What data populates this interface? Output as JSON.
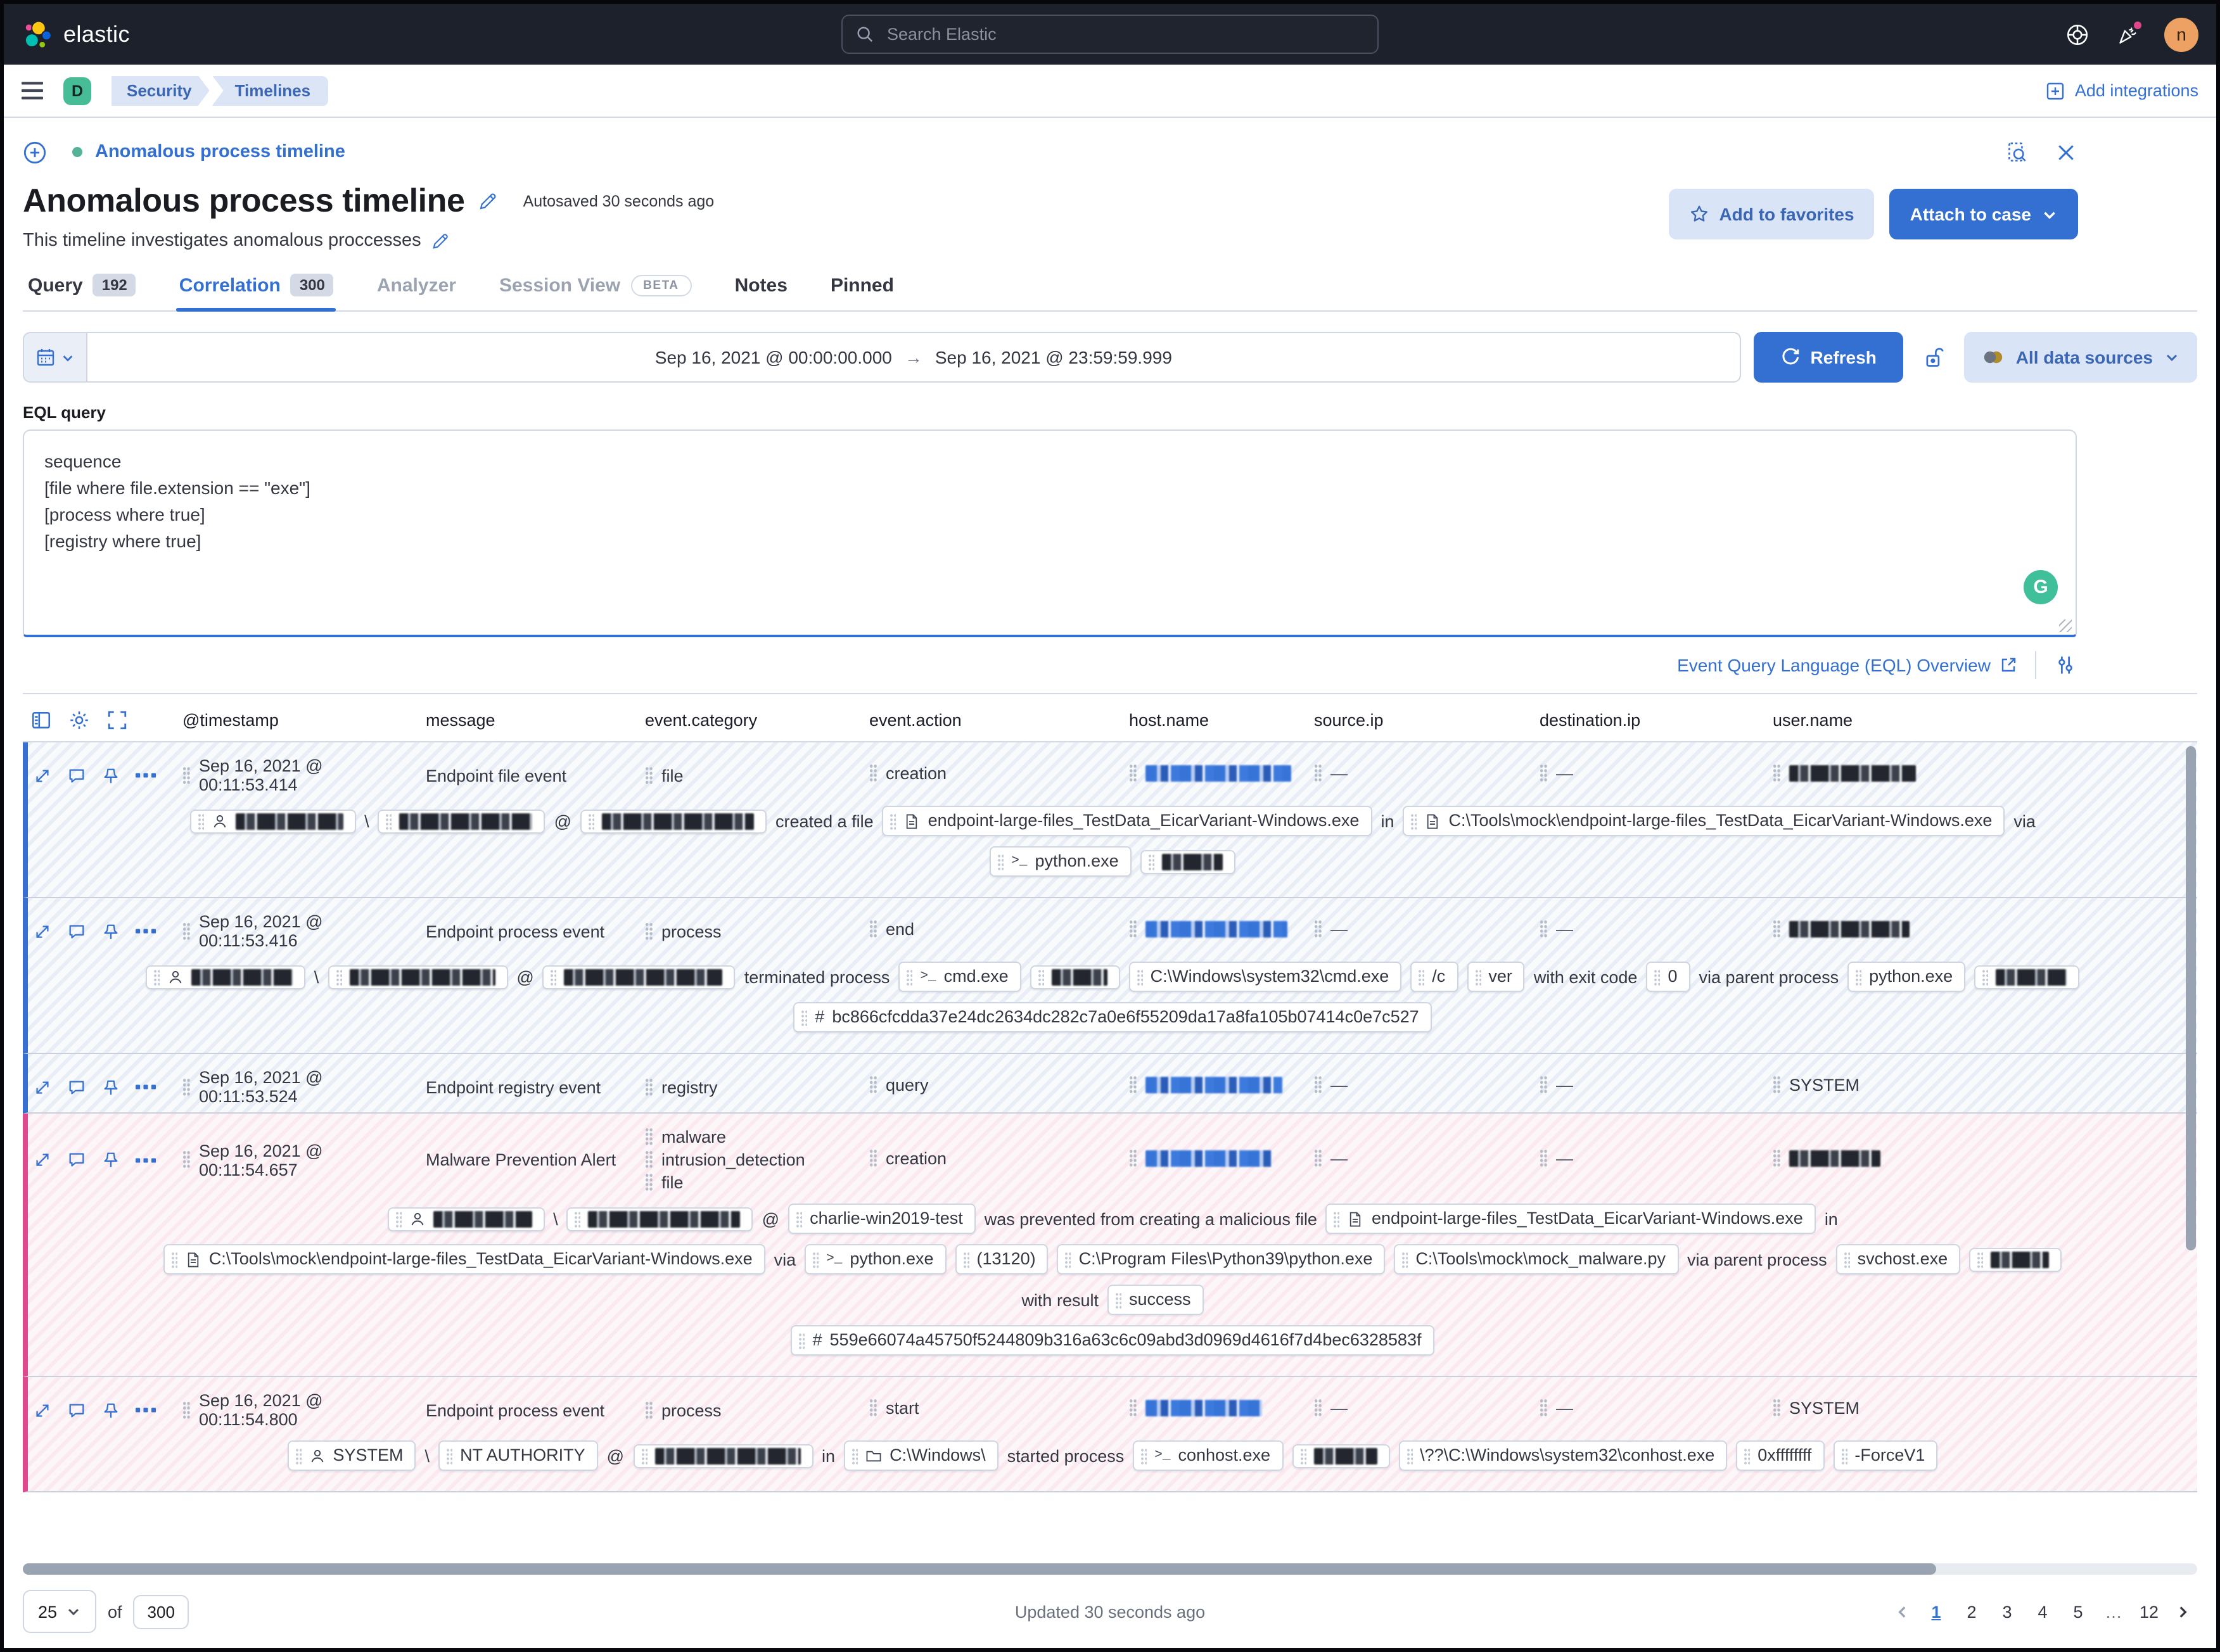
{
  "header": {
    "brand": "elastic",
    "search_placeholder": "Search Elastic",
    "avatar_initial": "n"
  },
  "nav": {
    "space_initial": "D",
    "breadcrumbs": [
      "Security",
      "Timelines"
    ],
    "add_integrations": "Add integrations"
  },
  "timeline": {
    "link_title": "Anomalous process timeline",
    "title": "Anomalous process timeline",
    "autosaved": "Autosaved 30 seconds ago",
    "description": "This timeline investigates anomalous proccesses",
    "favorites_button": "Add to favorites",
    "attach_button": "Attach to case"
  },
  "tabs": [
    {
      "label": "Query",
      "badge": "192"
    },
    {
      "label": "Correlation",
      "badge": "300"
    },
    {
      "label": "Analyzer"
    },
    {
      "label": "Session View",
      "beta": "BETA"
    },
    {
      "label": "Notes"
    },
    {
      "label": "Pinned"
    }
  ],
  "querybar": {
    "date_start": "Sep 16, 2021 @ 00:00:00.000",
    "range_arrow": "→",
    "date_end": "Sep 16, 2021 @ 23:59:59.999",
    "refresh": "Refresh",
    "data_sources": "All data sources"
  },
  "eql": {
    "label": "EQL query",
    "query": "sequence\n[file where file.extension == \"exe\"]\n[process where true]\n[registry where true]",
    "overview_link": "Event Query Language (EQL) Overview",
    "grammarly_badge": "G"
  },
  "table": {
    "columns": [
      "@timestamp",
      "message",
      "event.category",
      "event.action",
      "host.name",
      "source.ip",
      "destination.ip",
      "user.name"
    ],
    "rows": [
      {
        "kind": "event",
        "timestamp": "Sep 16, 2021 @ 00:11:53.414",
        "message": "Endpoint file event",
        "categories": [
          "file"
        ],
        "action": "creation",
        "host": {
          "redacted": "blue",
          "w": 115
        },
        "source_ip": "—",
        "destination_ip": "—",
        "user": {
          "redacted": "dark",
          "w": 100
        },
        "lines": [
          [
            {
              "chip": true,
              "icon": "user",
              "redacted": 85
            },
            {
              "text": "\\"
            },
            {
              "chip": true,
              "redacted": 105
            },
            {
              "text": "@"
            },
            {
              "chip": true,
              "redacted": 120
            },
            {
              "text": "created a file"
            },
            {
              "chip": true,
              "icon": "file",
              "text": "endpoint-large-files_TestData_EicarVariant-Windows.exe"
            },
            {
              "text": "in"
            },
            {
              "chip": true,
              "icon": "file",
              "text": "C:\\Tools\\mock\\endpoint-large-files_TestData_EicarVariant-Windows.exe"
            },
            {
              "text": "via"
            }
          ],
          [
            {
              "chip": true,
              "icon": "terminal",
              "text": "python.exe"
            },
            {
              "chip": true,
              "redacted": 48
            }
          ]
        ]
      },
      {
        "kind": "event",
        "timestamp": "Sep 16, 2021 @ 00:11:53.416",
        "message": "Endpoint process event",
        "categories": [
          "process"
        ],
        "action": "end",
        "host": {
          "redacted": "blue",
          "w": 112
        },
        "source_ip": "—",
        "destination_ip": "—",
        "user": {
          "redacted": "dark",
          "w": 95
        },
        "lines": [
          [
            {
              "chip": true,
              "icon": "user",
              "redacted": 80
            },
            {
              "text": "\\"
            },
            {
              "chip": true,
              "redacted": 115
            },
            {
              "text": "@"
            },
            {
              "chip": true,
              "redacted": 125
            },
            {
              "text": "terminated process"
            },
            {
              "chip": true,
              "icon": "terminal",
              "text": "cmd.exe"
            },
            {
              "chip": true,
              "redacted": 44
            },
            {
              "chip": true,
              "text": "C:\\Windows\\system32\\cmd.exe"
            },
            {
              "chip": true,
              "text": "/c"
            },
            {
              "chip": true,
              "text": "ver"
            },
            {
              "text": "with exit code"
            },
            {
              "chip": true,
              "text": "0"
            },
            {
              "text": "via parent process"
            },
            {
              "chip": true,
              "text": "python.exe"
            },
            {
              "chip": true,
              "redacted": 56
            }
          ],
          [
            {
              "chip": true,
              "icon": "hash",
              "text": "bc866cfcdda37e24dc2634dc282c7a0e6f55209da17a8fa105b07414c0e7c527"
            }
          ]
        ]
      },
      {
        "kind": "event",
        "timestamp": "Sep 16, 2021 @ 00:11:53.524",
        "message": "Endpoint registry event",
        "categories": [
          "registry"
        ],
        "action": "query",
        "host": {
          "redacted": "blue",
          "w": 108
        },
        "source_ip": "—",
        "destination_ip": "—",
        "user": "SYSTEM",
        "lines": []
      },
      {
        "kind": "alert",
        "timestamp": "Sep 16, 2021 @ 00:11:54.657",
        "message": "Malware Prevention Alert",
        "categories": [
          "malware",
          "intrusion_detection",
          "file"
        ],
        "action": "creation",
        "host": {
          "redacted": "blue",
          "w": 100
        },
        "source_ip": "—",
        "destination_ip": "—",
        "user": {
          "redacted": "dark",
          "w": 72
        },
        "lines": [
          [
            {
              "chip": true,
              "icon": "user",
              "redacted": 78
            },
            {
              "text": "\\"
            },
            {
              "chip": true,
              "redacted": 120
            },
            {
              "text": "@"
            },
            {
              "chip": true,
              "text": "charlie-win2019-test"
            },
            {
              "text": "was prevented from creating a malicious file"
            },
            {
              "chip": true,
              "icon": "file",
              "text": "endpoint-large-files_TestData_EicarVariant-Windows.exe"
            },
            {
              "text": "in"
            }
          ],
          [
            {
              "chip": true,
              "icon": "file",
              "text": "C:\\Tools\\mock\\endpoint-large-files_TestData_EicarVariant-Windows.exe"
            },
            {
              "text": "via"
            },
            {
              "chip": true,
              "icon": "terminal",
              "text": "python.exe"
            },
            {
              "chip": true,
              "text": "(13120)"
            },
            {
              "chip": true,
              "text": "C:\\Program Files\\Python39\\python.exe"
            },
            {
              "chip": true,
              "text": "C:\\Tools\\mock\\mock_malware.py"
            },
            {
              "text": "via parent process"
            },
            {
              "chip": true,
              "text": "svchost.exe"
            },
            {
              "chip": true,
              "redacted": 46
            }
          ],
          [
            {
              "text": "with result"
            },
            {
              "chip": true,
              "text": "success"
            }
          ],
          [
            {
              "chip": true,
              "icon": "hash",
              "text": "559e66074a45750f5244809b316a63c6c09abd3d0969d4616f7d4bec6328583f"
            }
          ]
        ]
      },
      {
        "kind": "alert",
        "timestamp": "Sep 16, 2021 @ 00:11:54.800",
        "message": "Endpoint process event",
        "categories": [
          "process"
        ],
        "action": "start",
        "host": {
          "redacted": "blue",
          "w": 92
        },
        "source_ip": "—",
        "destination_ip": "—",
        "user": "SYSTEM",
        "lines": [
          [
            {
              "chip": true,
              "icon": "user",
              "text": "SYSTEM"
            },
            {
              "text": "\\"
            },
            {
              "chip": true,
              "text": "NT AUTHORITY"
            },
            {
              "text": "@"
            },
            {
              "chip": true,
              "redacted": 115
            },
            {
              "text": "in"
            },
            {
              "chip": true,
              "icon": "folder",
              "text": "C:\\Windows\\"
            },
            {
              "text": "started process"
            },
            {
              "chip": true,
              "icon": "terminal",
              "text": "conhost.exe"
            },
            {
              "chip": true,
              "redacted": 50
            },
            {
              "chip": true,
              "text": "\\??\\C:\\Windows\\system32\\conhost.exe"
            },
            {
              "chip": true,
              "text": "0xffffffff"
            },
            {
              "chip": true,
              "text": "-ForceV1"
            }
          ]
        ]
      }
    ]
  },
  "footer": {
    "page_size": "25",
    "of_label": "of",
    "total": "300",
    "updated": "Updated 30 seconds ago",
    "pages": [
      "1",
      "2",
      "3",
      "4",
      "5"
    ],
    "active_page": "1",
    "ellipsis": "…",
    "last_page": "12"
  },
  "icons": {
    "search": "magnifier",
    "help": "life-buoy",
    "news": "party-popper",
    "menu": "hamburger",
    "inspect": "doc-magnifier",
    "close": "x",
    "edit": "pencil",
    "favorite": "star",
    "dropdown": "chevron-down",
    "calendar": "calendar",
    "refresh": "circular-arrow",
    "unlock": "open-padlock",
    "datasources": "two-overlapping-circles",
    "external": "arrow-out-of-box",
    "settings": "sliders",
    "grid_columns": "table-panel",
    "grid_settings": "gear",
    "grid_fullscreen": "corner-brackets",
    "row_expand": "diagonal-arrows",
    "row_comment": "speech-bubble",
    "row_pin": "pin",
    "row_more": "three-boxes",
    "chip_user": "person",
    "chip_file": "document",
    "chip_terminal": ">_",
    "chip_folder": "folder",
    "chip_hash": "#",
    "empty_value": "—"
  },
  "colors": {
    "primary": "#3470d2",
    "accent_event": "#3a6fd2",
    "accent_alert": "#df4a8d",
    "topbar": "#1d212b"
  }
}
